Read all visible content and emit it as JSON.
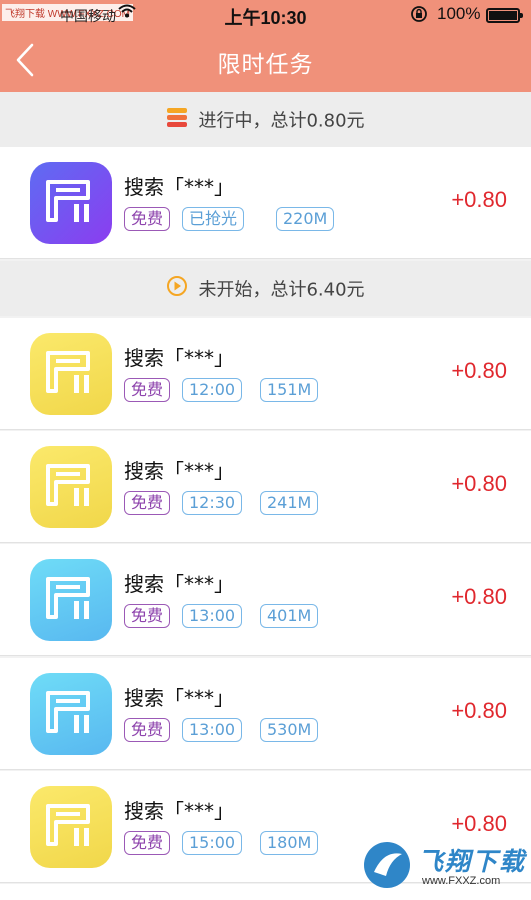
{
  "status_bar": {
    "watermark_badge": "飞翔下载 WWW.FXXZ.COM",
    "carrier": "中国移动",
    "time": "上午10:30",
    "battery_pct": "100%"
  },
  "nav": {
    "title": "限时任务",
    "back_icon": "chevron-left-icon"
  },
  "sections": [
    {
      "icon": "stack-icon",
      "text": "进行中，总计0.80元"
    },
    {
      "icon": "play-circle-icon",
      "text": "未开始，总计6.40元"
    }
  ],
  "tasks": [
    {
      "name": "搜索「***」",
      "tag_free": "免费",
      "tag_2": "已抢光",
      "tag_3": "220M",
      "reward": "+0.80",
      "icon_color": "purple"
    },
    {
      "name": "搜索「***」",
      "tag_free": "免费",
      "tag_2": "12:00",
      "tag_3": "151M",
      "reward": "+0.80",
      "icon_color": "yellow"
    },
    {
      "name": "搜索「***」",
      "tag_free": "免费",
      "tag_2": "12:30",
      "tag_3": "241M",
      "reward": "+0.80",
      "icon_color": "yellow"
    },
    {
      "name": "搜索「***」",
      "tag_free": "免费",
      "tag_2": "13:00",
      "tag_3": "401M",
      "reward": "+0.80",
      "icon_color": "cyan"
    },
    {
      "name": "搜索「***」",
      "tag_free": "免费",
      "tag_2": "13:00",
      "tag_3": "530M",
      "reward": "+0.80",
      "icon_color": "cyan"
    },
    {
      "name": "搜索「***」",
      "tag_free": "免费",
      "tag_2": "15:00",
      "tag_3": "180M",
      "reward": "+0.80",
      "icon_color": "yellow"
    }
  ],
  "watermark": {
    "logo_text": "飞翔下载",
    "url": "www.FXXZ.com"
  },
  "colors": {
    "header": "#f0917a",
    "reward": "#e0282e",
    "tag_free": "#8e44ad",
    "tag_info": "#5b9fd6"
  }
}
